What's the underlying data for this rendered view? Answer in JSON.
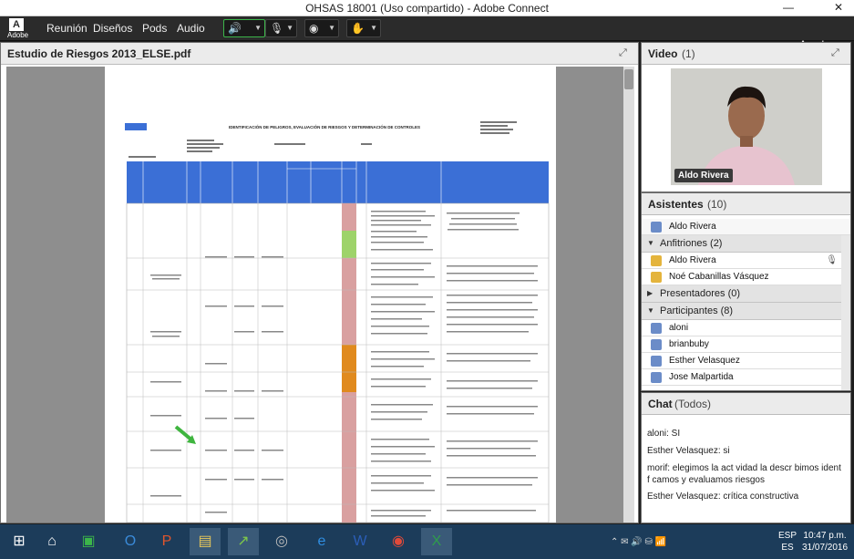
{
  "window": {
    "title": "OHSAS 18001 (Uso compartido) - Adobe Connect",
    "minimize": "—",
    "close": "✕"
  },
  "menubar": {
    "logo_label": "Adobe",
    "items": [
      "Reunión",
      "Diseños",
      "Pods",
      "Audio"
    ],
    "help": "Ayuda"
  },
  "document_pod": {
    "title": "Estudio de Riesgos 2013_ELSE.pdf",
    "doc_title": "IDENTIFICACIÓN DE PELIGROS, EVALUACIÓN DE RIESGOS Y DETERMINACIÓN DE CONTROLES"
  },
  "video_pod": {
    "title": "Video",
    "count": "(1)",
    "name_tag": "Aldo Rivera"
  },
  "attendees_pod": {
    "title": "Asistentes",
    "count": "(10)",
    "presenter_row": "Aldo Rivera",
    "groups": [
      {
        "label": "Anfitriones (2)",
        "members": [
          "Aldo Rivera",
          "Noé Cabanillas Vásquez"
        ]
      },
      {
        "label": "Presentadores (0)",
        "members": []
      },
      {
        "label": "Participantes (8)",
        "members": [
          "aloni",
          "brianbuby",
          "Esther Velasquez",
          "Jose Malpartida"
        ]
      }
    ]
  },
  "chat_pod": {
    "title": "Chat",
    "scope": "(Todos)",
    "messages": [
      {
        "author": "aloni:",
        "text": " SI"
      },
      {
        "author": "Esther Velasquez:",
        "text": " si"
      },
      {
        "author": "morif:",
        "text": " elegimos  la act vidad la descr bimos  ident f camos y evaluamos  riesgos"
      },
      {
        "author": "Esther Velasquez:",
        "text": " crítica constructiva"
      }
    ]
  },
  "taskbar": {
    "language": "ESP",
    "language_sub": "ES",
    "time": "10:47 p.m.",
    "date": "31/07/2016"
  },
  "colors": {
    "taskbar": "#1c3c5a",
    "menubar": "#2b2b2b",
    "accent_green": "#3cb54a",
    "risk_orange": "#e08a1e",
    "risk_pink": "#d9a0a0",
    "risk_green": "#9ed36a",
    "table_blue": "#3b6fd6"
  }
}
